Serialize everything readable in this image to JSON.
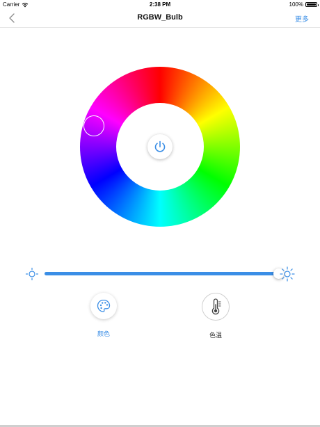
{
  "status_bar": {
    "carrier": "Carrier",
    "time": "2:38 PM",
    "battery": "100%"
  },
  "nav": {
    "title": "RGBW_Bulb",
    "more_label": "更多",
    "back_icon": "chevron-left-icon"
  },
  "color_wheel": {
    "selected_color": "#9b1dde",
    "power_icon": "power-icon",
    "power_color": "#3a8ee6"
  },
  "brightness": {
    "level_percent": 100,
    "min_icon": "sun-small-icon",
    "max_icon": "sun-large-icon",
    "accent_color": "#3a8ee6"
  },
  "modes": [
    {
      "label": "颜色",
      "icon": "palette-icon",
      "active": true
    },
    {
      "label": "色温",
      "icon": "thermometer-icon",
      "active": false
    }
  ]
}
